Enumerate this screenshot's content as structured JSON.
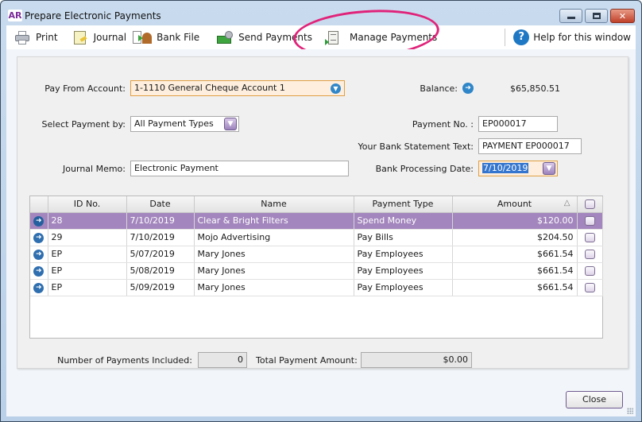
{
  "window": {
    "app_badge": "AR",
    "title": "Prepare Electronic Payments",
    "controls": {
      "minimize": "minimize",
      "maximize": "maximize",
      "close": "✕"
    }
  },
  "toolbar": {
    "print": "Print",
    "journal": "Journal",
    "bank_file": "Bank File",
    "send_payments": "Send Payments",
    "manage_payments": "Manage Payments",
    "help": "Help for this window",
    "help_glyph": "?"
  },
  "form": {
    "pay_from_label": "Pay From Account:",
    "pay_from_value": "1-1110 General Cheque Account 1",
    "balance_label": "Balance:",
    "balance_value": "$65,850.51",
    "select_payment_label": "Select Payment by:",
    "select_payment_value": "All Payment Types",
    "payment_no_label": "Payment No. :",
    "payment_no_value": "EP000017",
    "bank_statement_label": "Your Bank Statement Text:",
    "bank_statement_value": "PAYMENT EP000017",
    "journal_memo_label": "Journal Memo:",
    "journal_memo_value": "Electronic Payment",
    "bank_date_label": "Bank Processing Date:",
    "bank_date_value": "7/10/2019"
  },
  "grid": {
    "columns": [
      "",
      "ID No.",
      "Date",
      "Name",
      "Payment Type",
      "Amount",
      ""
    ],
    "sort_indicator": "△",
    "rows": [
      {
        "id": "28",
        "date": "7/10/2019",
        "name": "Clear & Bright Filters",
        "type": "Spend Money",
        "amount": "$120.00",
        "selected": true
      },
      {
        "id": "29",
        "date": "7/10/2019",
        "name": "Mojo Advertising",
        "type": "Pay Bills",
        "amount": "$204.50",
        "selected": false
      },
      {
        "id": "EP",
        "date": "5/07/2019",
        "name": "Mary Jones",
        "type": "Pay Employees",
        "amount": "$661.54",
        "selected": false
      },
      {
        "id": "EP",
        "date": "5/08/2019",
        "name": "Mary Jones",
        "type": "Pay Employees",
        "amount": "$661.54",
        "selected": false
      },
      {
        "id": "EP",
        "date": "5/09/2019",
        "name": "Mary Jones",
        "type": "Pay Employees",
        "amount": "$661.54",
        "selected": false
      }
    ]
  },
  "totals": {
    "count_label": "Number of Payments Included:",
    "count_value": "0",
    "amount_label": "Total Payment Amount:",
    "amount_value": "$0.00"
  },
  "footer": {
    "close": "Close"
  },
  "colors": {
    "selected_row": "#a386bd",
    "annotation_circle": "#e0237a",
    "highlight_field": "#fdeedd"
  }
}
